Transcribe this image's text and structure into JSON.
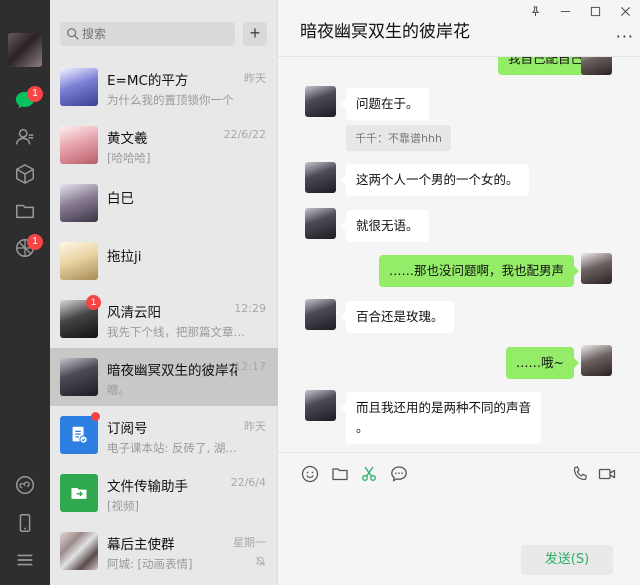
{
  "search": {
    "placeholder": "搜索"
  },
  "add_button_label": "+",
  "sidebar": {
    "chat_badge": "1",
    "moments_badge": "1"
  },
  "chats": [
    {
      "name": "E=MC的平方",
      "time": "昨天",
      "preview": "为什么我的置顶锁你一个"
    },
    {
      "name": "黄文羲",
      "time": "22/6/22",
      "preview": "[哈哈哈]"
    },
    {
      "name": "白巳",
      "time": "",
      "preview": ""
    },
    {
      "name": "拖拉ji",
      "time": "",
      "preview": ""
    },
    {
      "name": "风清云阳",
      "time": "12:29",
      "preview": "我先下个线，把那篇文章…",
      "badge": "1"
    },
    {
      "name": "暗夜幽冥双生的彼岸花",
      "time": "12:17",
      "preview": "嗯。"
    },
    {
      "name": "订阅号",
      "time": "昨天",
      "preview": "电子课本站: 反砖了, 湖…"
    },
    {
      "name": "文件传输助手",
      "time": "22/6/4",
      "preview": "[视频]"
    },
    {
      "name": "幕后主使群",
      "time": "星期一",
      "preview": "阿城: [动画表情]"
    }
  ],
  "conversation": {
    "title": "暗夜幽冥双生的彼岸花",
    "more": "···",
    "messages": [
      {
        "side": "right",
        "text": "我自己配自己"
      },
      {
        "side": "left",
        "text": "问题在于。"
      },
      {
        "side": "quote",
        "text": "千千：不靠谱hhh"
      },
      {
        "side": "left",
        "text": "这两个人一个男的一个女的。"
      },
      {
        "side": "left",
        "text": "就很无语。"
      },
      {
        "side": "right",
        "text": "……那也没问题啊，我也配男声"
      },
      {
        "side": "left",
        "text": "百合还是玫瑰。"
      },
      {
        "side": "right",
        "text": "……哦~"
      },
      {
        "side": "left",
        "text": "而且我还用的是两种不同的声音",
        "text2": "。"
      }
    ],
    "send_label": "发送(S)"
  },
  "colors": {
    "accent": "#07c160",
    "bubble_right": "#95ec69",
    "badge": "#f54545",
    "sidebar": "#2e2e2e"
  }
}
